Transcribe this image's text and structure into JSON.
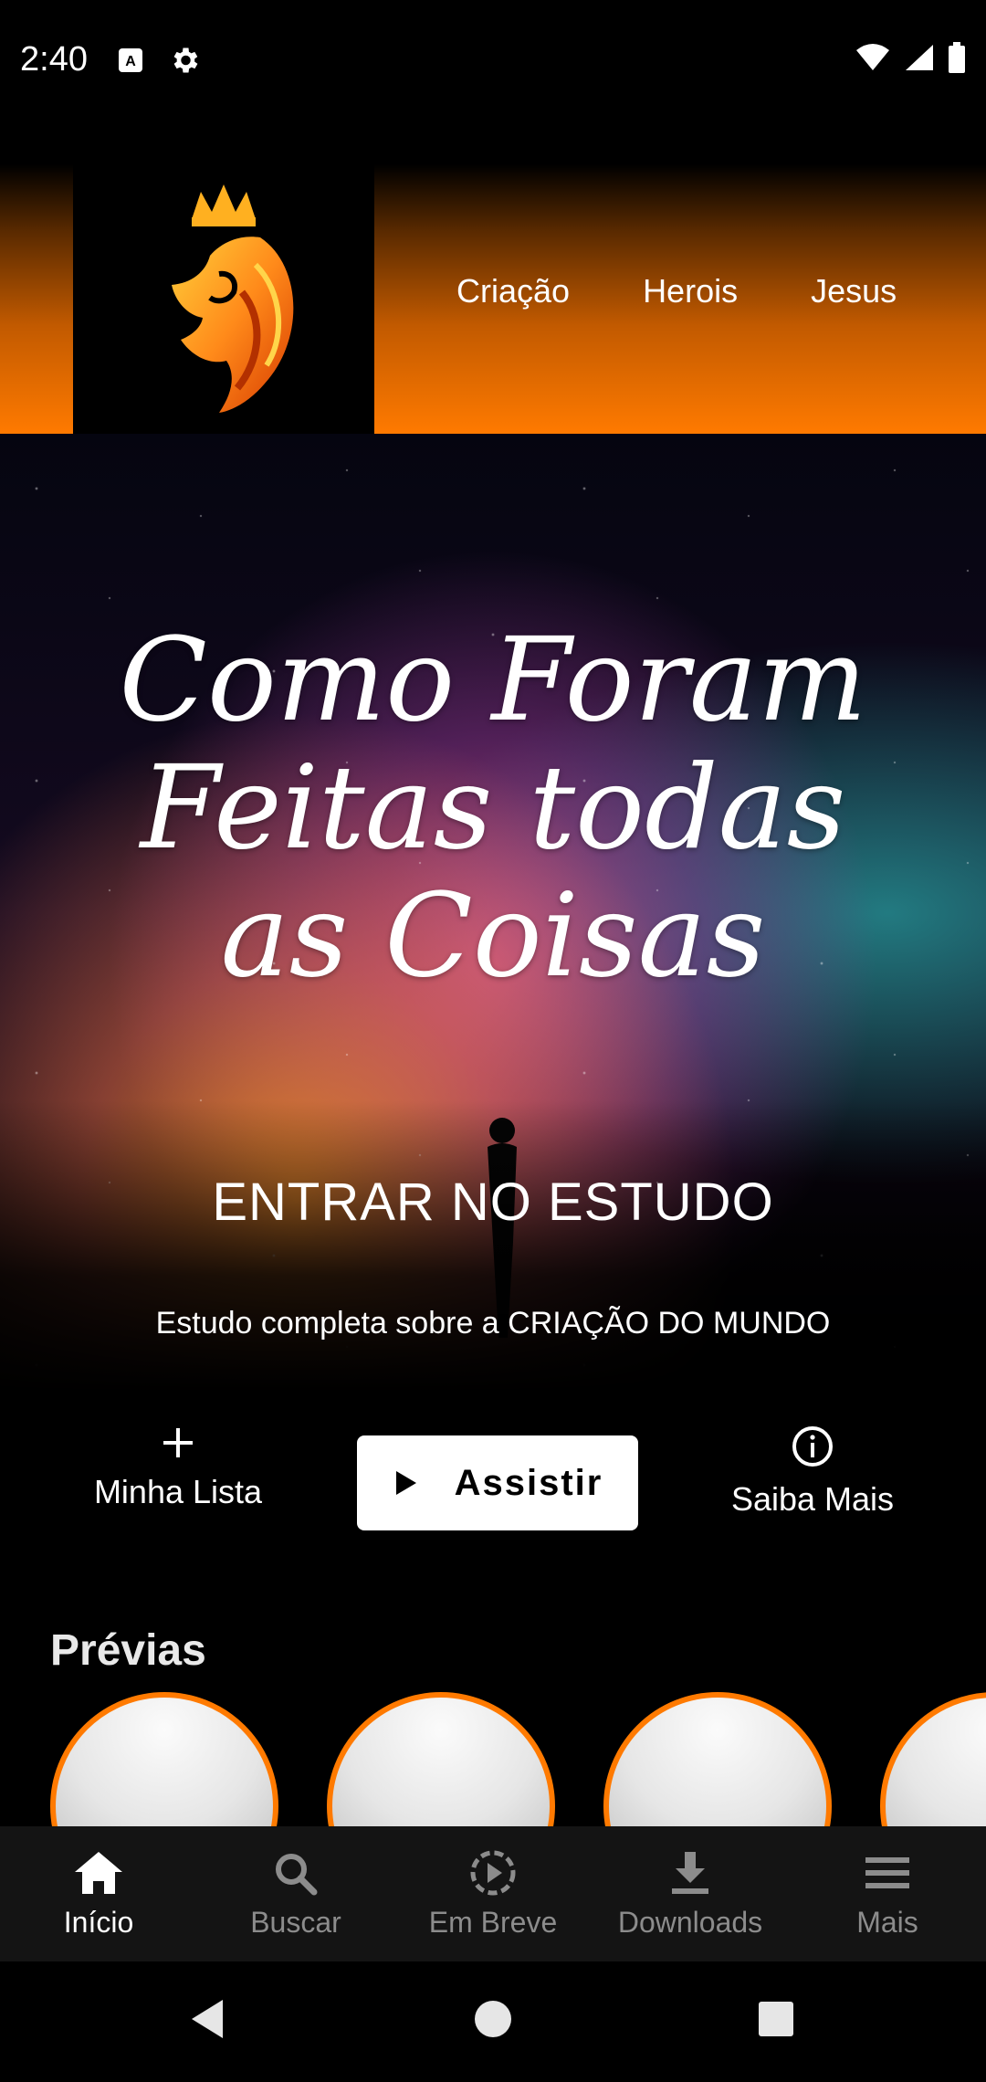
{
  "status_bar": {
    "time": "2:40"
  },
  "top_nav": {
    "items": [
      "Criação",
      "Herois",
      "Jesus"
    ]
  },
  "hero": {
    "title_line1": "Como Foram",
    "title_line2": "Feitas todas",
    "title_line3": "as Coisas",
    "cta": "ENTRAR NO ESTUDO",
    "subtitle": "Estudo completa sobre a CRIAÇÃO DO MUNDO"
  },
  "actions": {
    "my_list_label": "Minha Lista",
    "play_label": "Assistir",
    "more_info_label": "Saiba Mais"
  },
  "previews": {
    "title": "Prévias",
    "count": 4
  },
  "bottom_nav": {
    "tabs": [
      {
        "label": "Início",
        "icon": "home-icon",
        "active": true
      },
      {
        "label": "Buscar",
        "icon": "search-icon",
        "active": false
      },
      {
        "label": "Em Breve",
        "icon": "coming-soon-icon",
        "active": false
      },
      {
        "label": "Downloads",
        "icon": "download-icon",
        "active": false
      },
      {
        "label": "Mais",
        "icon": "menu-icon",
        "active": false
      }
    ]
  },
  "colors": {
    "accent": "#ff7a00",
    "background": "#000000",
    "tab_bar": "#141414"
  }
}
